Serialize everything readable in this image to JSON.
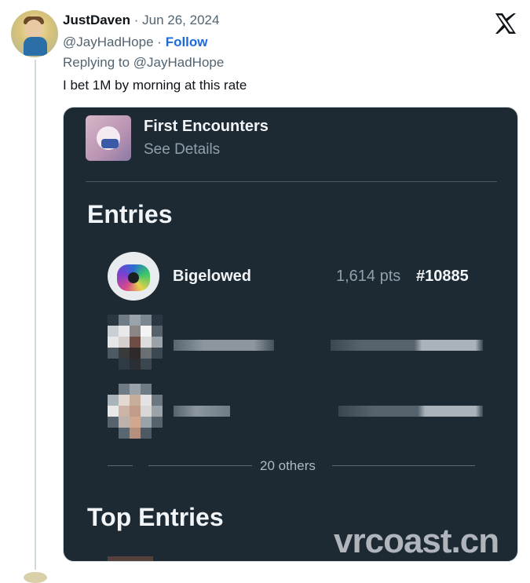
{
  "tweet": {
    "author_name": "JustDaven",
    "separator": "·",
    "date": "Jun 26, 2024",
    "handle": "@JayHadHope",
    "follow_label": "Follow",
    "replying_to": "Replying to @JayHadHope",
    "text": "I bet 1M by morning at this rate"
  },
  "icons": {
    "platform_logo": "x-logo-icon"
  },
  "media": {
    "event_title": "First Encounters",
    "see_details": "See Details",
    "entries_heading": "Entries",
    "entry": {
      "name": "Bigelowed",
      "points": "1,614 pts",
      "rank": "#10885"
    },
    "others_label": "20 others",
    "top_entries_heading": "Top Entries",
    "watermark": "vrcoast.cn"
  },
  "colors": {
    "link": "#1d6ad8",
    "card_background": "#1e2a33",
    "muted_text": "#536471"
  }
}
